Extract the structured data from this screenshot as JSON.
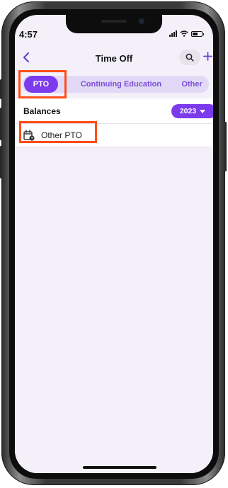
{
  "status_bar": {
    "time": "4:57"
  },
  "nav": {
    "back_icon": "chevron-left-icon",
    "title": "Time Off",
    "search_icon": "search-icon",
    "add_icon": "plus-icon"
  },
  "tabs": [
    {
      "label": "PTO",
      "active": true
    },
    {
      "label": "Continuing Education",
      "active": false
    },
    {
      "label": "Other",
      "active": false
    }
  ],
  "balances": {
    "label": "Balances",
    "year": "2023",
    "year_icon": "caret-down-icon"
  },
  "items": [
    {
      "label": "Other PTO",
      "icon": "calendar-clock-icon"
    }
  ],
  "colors": {
    "accent": "#7c3aed",
    "tab_bar_bg": "#e2d9f7",
    "highlight": "#ff4d17",
    "screen_bg": "#f3f0f9"
  }
}
